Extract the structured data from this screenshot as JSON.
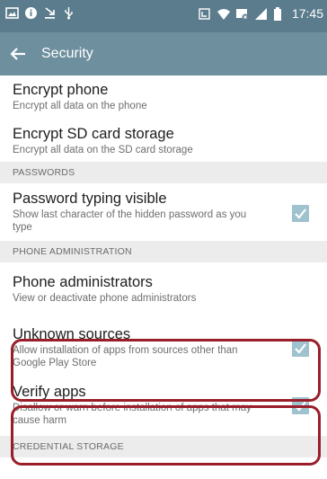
{
  "status_bar": {
    "time": "17:45",
    "icons_left": [
      "gallery-icon",
      "info-icon",
      "download-icon",
      "usb-icon"
    ],
    "icons_right": [
      "nfc-icon",
      "wifi-icon",
      "data-saver-icon",
      "signal-icon",
      "battery-icon"
    ]
  },
  "app_bar": {
    "title": "Security",
    "back_icon": "back-arrow-icon"
  },
  "items": {
    "encrypt_phone": {
      "title": "Encrypt phone",
      "summary": "Encrypt all data on the phone"
    },
    "encrypt_sd": {
      "title": "Encrypt SD card storage",
      "summary": "Encrypt all data on the SD card storage"
    },
    "password_visible": {
      "title": "Password typing visible",
      "summary": "Show last character of the hidden password as you type",
      "checked": true
    },
    "phone_admins": {
      "title": "Phone administrators",
      "summary": "View or deactivate phone administrators"
    },
    "unknown_sources": {
      "title": "Unknown sources",
      "summary": "Allow installation of apps from sources other than Google Play Store",
      "checked": true
    },
    "verify_apps": {
      "title": "Verify apps",
      "summary": "Disallow or warn before installation of apps that may cause harm",
      "checked": true
    }
  },
  "sections": {
    "passwords": "PASSWORDS",
    "phone_administration": "PHONE ADMINISTRATION",
    "credential_storage": "CREDENTIAL STORAGE"
  },
  "colors": {
    "status_bar": "#5b7c8c",
    "app_bar": "#6e8f9e",
    "checkbox": "#9fc2cf",
    "highlight": "#9a1e2a"
  }
}
